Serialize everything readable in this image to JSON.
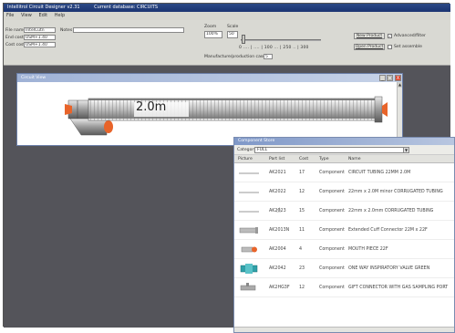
{
  "app": {
    "title": "Intellitrol Circuit Designer v2.31",
    "database_label": "Current database: CIRCUITS"
  },
  "menu": [
    "File",
    "View",
    "Edit",
    "Help"
  ],
  "fields": {
    "file_name_label": "File name",
    "file_name_value": "IntelCutn",
    "notes_label": "Notes",
    "notes_value": "",
    "end_cost_label": "End cost",
    "end_cost_value": "USM+1.40",
    "cost_cost_label": "Cost cost",
    "cost_cost_value": "USM+1.40"
  },
  "zoom": {
    "label": "Zoom",
    "value": "100%",
    "scale_label": "Scale",
    "scale_value": "50",
    "ticks": "0 .... | .... | 100 ... | 250 .. | 300"
  },
  "manufacture": {
    "label": "Manufacture/production case",
    "value": "5"
  },
  "buttons": {
    "new_product": "New Product",
    "open_product": "Open Product"
  },
  "options": {
    "advanced": "Advanced/filter",
    "assemble": "Set assemble",
    "advanced_checked": true,
    "assemble_checked": false
  },
  "circuit_view": {
    "title": "Circuit View",
    "tube_length": "2.0m",
    "min": "_",
    "max": "□",
    "close": "X"
  },
  "component_store": {
    "title": "Component Store",
    "category_label": "Category",
    "category_value": "FULL",
    "columns": [
      "Picture",
      "Part list",
      "Cost",
      "Type",
      "Name"
    ],
    "rows": [
      {
        "part": "AK2021",
        "cost": "17",
        "type": "Component",
        "name": "CIRCUIT TUBING 22MM 2.0M"
      },
      {
        "part": "AK2022",
        "cost": "12",
        "type": "Component",
        "name": "22mm x 2.0M minor CORRUGATED TUBING"
      },
      {
        "part": "AK2023",
        "cost": "15",
        "type": "Component",
        "name": "22mm x 2.0mm CORRUGATED TUBING"
      },
      {
        "part": "AK2013N",
        "cost": "11",
        "type": "Component",
        "name": "Extended Cuff Connector 22M x 22F"
      },
      {
        "part": "AK2004",
        "cost": "4",
        "type": "Component",
        "name": "MOUTH PIECE 22F"
      },
      {
        "part": "AK2042",
        "cost": "23",
        "type": "Component",
        "name": "ONE WAY INSPIRATORY VALVE GREEN"
      },
      {
        "part": "AK2HG3F",
        "cost": "12",
        "type": "Component",
        "name": "GIFT CONNECTOR WITH GAS SAMPLING PORT"
      }
    ]
  },
  "colors": {
    "accent_orange": "#e8642a",
    "titlebar_blue": "#1a3370",
    "frame_dark": "#3c3c44"
  }
}
